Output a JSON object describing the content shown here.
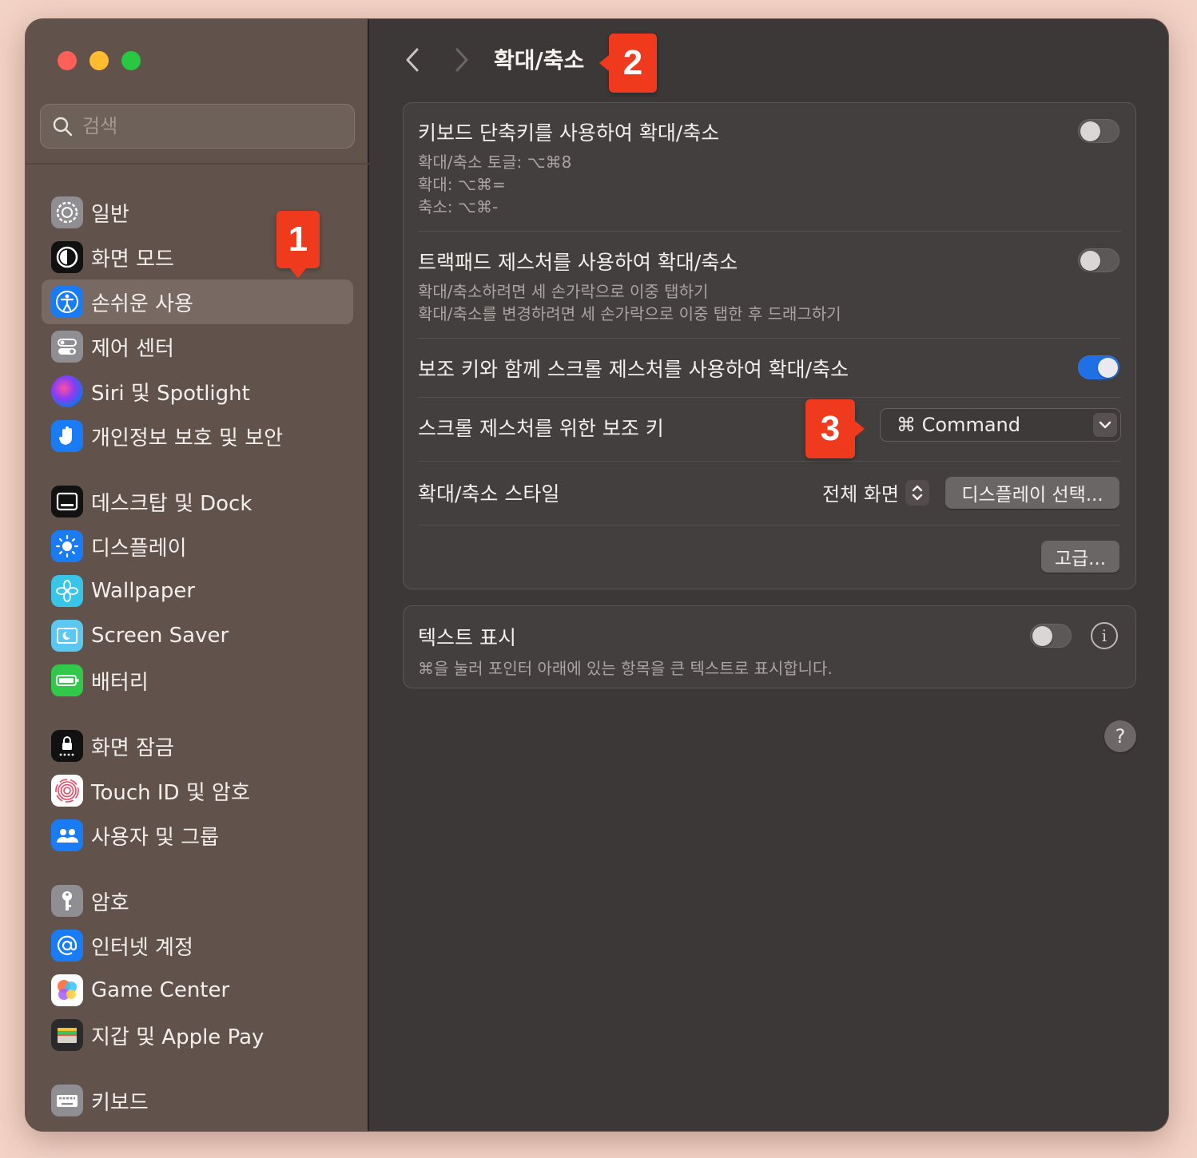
{
  "window": {
    "search_placeholder": "검색",
    "page_title": "확대/축소"
  },
  "sidebar": {
    "items": [
      {
        "label": "일반",
        "icon": "gear-icon"
      },
      {
        "label": "화면 모드",
        "icon": "appearance-icon"
      },
      {
        "label": "손쉬운 사용",
        "icon": "accessibility-icon",
        "selected": true
      },
      {
        "label": "제어 센터",
        "icon": "control-center-icon"
      },
      {
        "label": "Siri 및 Spotlight",
        "icon": "siri-icon"
      },
      {
        "label": "개인정보 보호 및 보안",
        "icon": "privacy-hand-icon"
      },
      {
        "label": "데스크탑 및 Dock",
        "icon": "dock-icon"
      },
      {
        "label": "디스플레이",
        "icon": "display-sun-icon"
      },
      {
        "label": "Wallpaper",
        "icon": "wallpaper-flower-icon"
      },
      {
        "label": "Screen Saver",
        "icon": "screen-saver-icon"
      },
      {
        "label": "배터리",
        "icon": "battery-icon"
      },
      {
        "label": "화면 잠금",
        "icon": "lock-screen-icon"
      },
      {
        "label": "Touch ID 및 암호",
        "icon": "fingerprint-icon"
      },
      {
        "label": "사용자 및 그룹",
        "icon": "users-icon"
      },
      {
        "label": "암호",
        "icon": "key-icon"
      },
      {
        "label": "인터넷 계정",
        "icon": "at-sign-icon"
      },
      {
        "label": "Game Center",
        "icon": "game-center-icon"
      },
      {
        "label": "지갑 및 Apple Pay",
        "icon": "wallet-icon"
      },
      {
        "label": "키보드",
        "icon": "keyboard-icon"
      }
    ]
  },
  "zoom": {
    "keyboard_shortcuts": {
      "title": "키보드 단축키를 사용하여 확대/축소",
      "lines": [
        "확대/축소 토글: ⌥⌘8",
        "확대: ⌥⌘=",
        "축소: ⌥⌘-"
      ],
      "enabled": false
    },
    "trackpad": {
      "title": "트랙패드 제스처를 사용하여 확대/축소",
      "lines": [
        "확대/축소하려면 세 손가락으로 이중 탭하기",
        "확대/축소를 변경하려면 세 손가락으로 이중 탭한 후 드래그하기"
      ],
      "enabled": false
    },
    "scroll_modifier": {
      "title": "보조 키와 함께 스크롤 제스처를 사용하여 확대/축소",
      "enabled": true
    },
    "modifier_key": {
      "label": "스크롤 제스처를 위한 보조 키",
      "value": "⌘ Command"
    },
    "zoom_style": {
      "label": "확대/축소 스타일",
      "value": "전체 화면",
      "display_button": "디스플레이 선택..."
    },
    "advanced_button": "고급..."
  },
  "hover_text": {
    "title": "텍스트 표시",
    "description": "⌘을 눌러 포인터 아래에 있는 항목을 큰 텍스트로 표시합니다.",
    "enabled": false
  },
  "annotations": [
    "1",
    "2",
    "3"
  ],
  "colors": {
    "accent": "#1f6fe5",
    "badge": "#f03a1e"
  }
}
